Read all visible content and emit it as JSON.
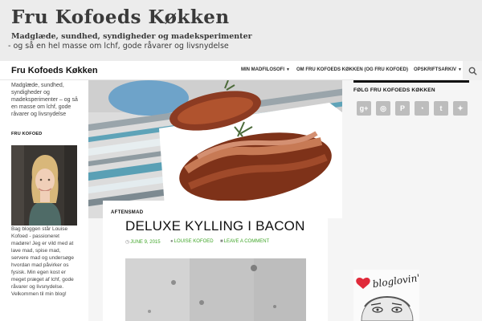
{
  "banner": {
    "title": "Fru Kofoeds Køkken",
    "subtitle1": "Madglæde, sundhed, syndigheder og madeksperimenter",
    "subtitle2": "- og så en hel masse om lchf, gode råvarer og livsnydelse"
  },
  "nav": {
    "site_title": "Fru Kofoeds Køkken",
    "items": [
      {
        "label": "Min madfilosofi",
        "has_dropdown": true
      },
      {
        "label": "Om Fru Kofoeds Køkken (og Fru Kofoed)",
        "has_dropdown": false
      },
      {
        "label": "Opskriftsarkiv",
        "has_dropdown": true
      }
    ],
    "search_icon": "search-icon"
  },
  "left_sidebar": {
    "tagline": "Madglæde, sundhed, syndigheder og madeksperimenter – og så en masse om lchf, gode råvarer og livsnydelse",
    "heading": "FRU KOFOED",
    "bio": "Bag bloggen står Louise Kofoed - passioneret madøre! Jeg er vild med at lave mad, spise mad, servere mad og undersøge hvordan mad påvirker os fysisk. Min egen kost er meget præget af lchf, gode råvarer og livsnydelse. Velkommen til min blog!"
  },
  "post": {
    "category": "AFTENSMAD",
    "title": "DELUXE KYLLING I BACON",
    "date": "JUNE 9, 2015",
    "author": "LOUISE KOFOED",
    "comment": "LEAVE A COMMENT"
  },
  "right_sidebar": {
    "follow_title": "FØLG FRU KOFOEDS KØKKEN",
    "social_icons": [
      "google-plus-icon",
      "instagram-icon",
      "pinterest-icon",
      "rss-icon",
      "tumblr-icon",
      "twitter-icon"
    ],
    "social_glyphs": [
      "g+",
      "◎",
      "P",
      "◔",
      "t",
      "✦"
    ],
    "bloglovin_logo": "bloglovin'"
  },
  "colors": {
    "accent_green": "#41a62a",
    "banner_bg": "#ececec",
    "social_grey": "#bdbdbd"
  }
}
